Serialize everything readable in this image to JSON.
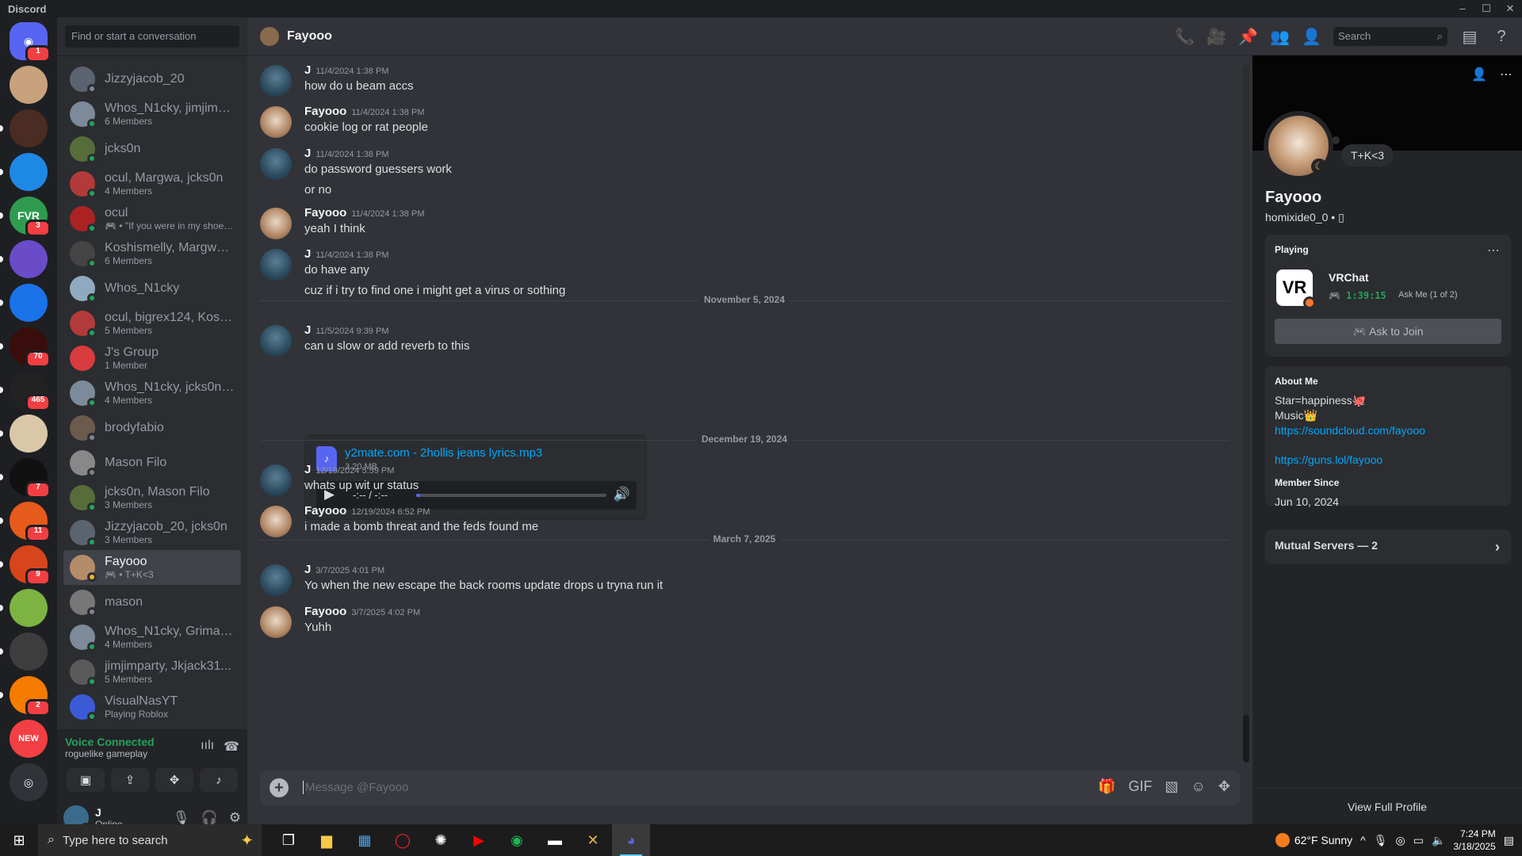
{
  "window": {
    "title": "Discord",
    "controls": [
      "–",
      "☐",
      "✕"
    ]
  },
  "servers": [
    {
      "label": "",
      "badge": "1",
      "color": "#5865f2",
      "icon": "discord-logo"
    },
    {
      "label": "",
      "badge": "",
      "color": "#c7a27c"
    },
    {
      "label": "",
      "badge": "",
      "color": "#4b2c22"
    },
    {
      "label": "",
      "badge": "",
      "color": "#1e88e5"
    },
    {
      "label": "FVR",
      "badge": "3",
      "color": "#2e9b4f"
    },
    {
      "label": "",
      "badge": "",
      "color": "#6a4bc8"
    },
    {
      "label": "",
      "badge": "",
      "color": "#1a73e8"
    },
    {
      "label": "",
      "badge": "70",
      "color": "#3a0d0d"
    },
    {
      "label": "",
      "badge": "465",
      "color": "#222"
    },
    {
      "label": "",
      "badge": "",
      "color": "#d9c7a8"
    },
    {
      "label": "",
      "badge": "7",
      "color": "#111"
    },
    {
      "label": "",
      "badge": "11",
      "color": "#e65a1c"
    },
    {
      "label": "",
      "badge": "9",
      "color": "#d6451b"
    },
    {
      "label": "",
      "badge": "",
      "color": "#7cb342"
    },
    {
      "label": "",
      "badge": "",
      "color": "#3d3d3d"
    },
    {
      "label": "",
      "badge": "2",
      "color": "#f57c00"
    }
  ],
  "new_badge": "NEW",
  "dm": {
    "search_placeholder": "Find or start a conversation",
    "items": [
      {
        "name": "Jizzyjacob_20",
        "sub": "",
        "status": "off",
        "color": "#5c6370"
      },
      {
        "name": "Whos_N1cky, jimjimpa...",
        "sub": "6 Members",
        "status": "on",
        "color": "#7c8a99"
      },
      {
        "name": "jcks0n",
        "sub": "",
        "status": "on",
        "color": "#566d3a"
      },
      {
        "name": "ocul, Margwa, jcks0n",
        "sub": "4 Members",
        "status": "on",
        "color": "#b33a3a"
      },
      {
        "name": "ocul",
        "sub": "🎮 • \"If you were in my shoes ...",
        "status": "on",
        "color": "#a22"
      },
      {
        "name": "Koshismelly, Margwa, ...",
        "sub": "6 Members",
        "status": "on",
        "color": "#444"
      },
      {
        "name": "Whos_N1cky",
        "sub": "",
        "status": "on",
        "color": "#8faac0"
      },
      {
        "name": "ocul, bigrex124, Koshi...",
        "sub": "5 Members",
        "status": "on",
        "color": "#b33a3a"
      },
      {
        "name": "J's Group",
        "sub": "1 Member",
        "status": "none",
        "color": "#d83c3e"
      },
      {
        "name": "Whos_N1cky, jcks0n, ...",
        "sub": "4 Members",
        "status": "on",
        "color": "#7c8a99"
      },
      {
        "name": "brodyfabio",
        "sub": "",
        "status": "off",
        "color": "#6b5b4d"
      },
      {
        "name": "Mason Filo",
        "sub": "",
        "status": "off",
        "color": "#888"
      },
      {
        "name": "jcks0n, Mason Filo",
        "sub": "3 Members",
        "status": "on",
        "color": "#566d3a"
      },
      {
        "name": "Jizzyjacob_20, jcks0n",
        "sub": "3 Members",
        "status": "on",
        "color": "#5c6370"
      },
      {
        "name": "Fayooo",
        "sub": "🎮 • T+K<3",
        "status": "idle",
        "color": "#b58c6a"
      },
      {
        "name": "mason",
        "sub": "",
        "status": "off",
        "color": "#777"
      },
      {
        "name": "Whos_N1cky, Grimace...",
        "sub": "4 Members",
        "status": "on",
        "color": "#7c8a99"
      },
      {
        "name": "jimjimparty, Jkjack31...",
        "sub": "5 Members",
        "status": "on",
        "color": "#5a5a5a"
      },
      {
        "name": "VisualNasYT",
        "sub": "Playing Roblox",
        "status": "on",
        "color": "#3b5bd6"
      }
    ],
    "selected_index": 14
  },
  "voice": {
    "status": "Voice Connected",
    "channel": "roguelike gameplay"
  },
  "user": {
    "name": "J",
    "status": "Online"
  },
  "chat": {
    "title": "Fayooo",
    "search_placeholder": "Search",
    "composer_placeholder": "Message @Fayooo",
    "messages": [
      {
        "author": "J",
        "time": "11/4/2024 1:38 PM",
        "lines": [
          "how do u beam accs"
        ],
        "av": "j"
      },
      {
        "author": "Fayooo",
        "time": "11/4/2024 1:38 PM",
        "lines": [
          "cookie log or rat people"
        ],
        "av": "f"
      },
      {
        "author": "J",
        "time": "11/4/2024 1:38 PM",
        "lines": [
          "do password guessers work",
          "or no"
        ],
        "av": "j"
      },
      {
        "author": "Fayooo",
        "time": "11/4/2024 1:38 PM",
        "lines": [
          "yeah I think"
        ],
        "av": "f"
      },
      {
        "author": "J",
        "time": "11/4/2024 1:38 PM",
        "lines": [
          "do have any",
          "cuz if i try to find one i might get a virus or sothing"
        ],
        "av": "j"
      },
      {
        "author": "J",
        "time": "11/5/2024 9:39 PM",
        "lines": [
          "can u slow or add reverb to this"
        ],
        "av": "j"
      },
      {
        "author": "J",
        "time": "12/19/2024 5:59 PM",
        "lines": [
          "whats up wit ur status"
        ],
        "av": "j"
      },
      {
        "author": "Fayooo",
        "time": "12/19/2024 6:52 PM",
        "lines": [
          "i made a bomb threat and the feds found me"
        ],
        "av": "f"
      },
      {
        "author": "J",
        "time": "3/7/2025 4:01 PM",
        "lines": [
          "Yo when the new escape the back rooms update drops u tryna run it"
        ],
        "av": "j"
      },
      {
        "author": "Fayooo",
        "time": "3/7/2025 4:02 PM",
        "lines": [
          "Yuhh"
        ],
        "av": "f"
      }
    ],
    "dividers": [
      "November 5, 2024",
      "December 19, 2024",
      "March 7, 2025"
    ],
    "attachment": {
      "name": "y2mate.com - 2hollis jeans lyrics.mp3",
      "size": "3.20 MB",
      "time": "-:-- / -:--",
      "progress": 0.02
    }
  },
  "profile": {
    "name": "Fayooo",
    "handle": "homixide0_0 • ▯",
    "custom_status": "T+K<3",
    "playing_label": "Playing",
    "game": "VRChat",
    "game_icon": "VR",
    "elapsed": "1:39:15",
    "party": "Ask Me (1 of 2)",
    "ask_button": "Ask to Join",
    "about_title": "About Me",
    "about_lines": [
      "Star=happiness🐙",
      "Music👑"
    ],
    "links": [
      "https://soundcloud.com/fayooo",
      "https://guns.lol/fayooo"
    ],
    "member_since_title": "Member Since",
    "member_since": "Jun 10, 2024",
    "mutual": "Mutual Servers — 2",
    "view_full": "View Full Profile"
  },
  "taskbar": {
    "search_placeholder": "Type here to search",
    "weather": "62°F  Sunny",
    "time": "7:24 PM",
    "date": "3/18/2025"
  }
}
